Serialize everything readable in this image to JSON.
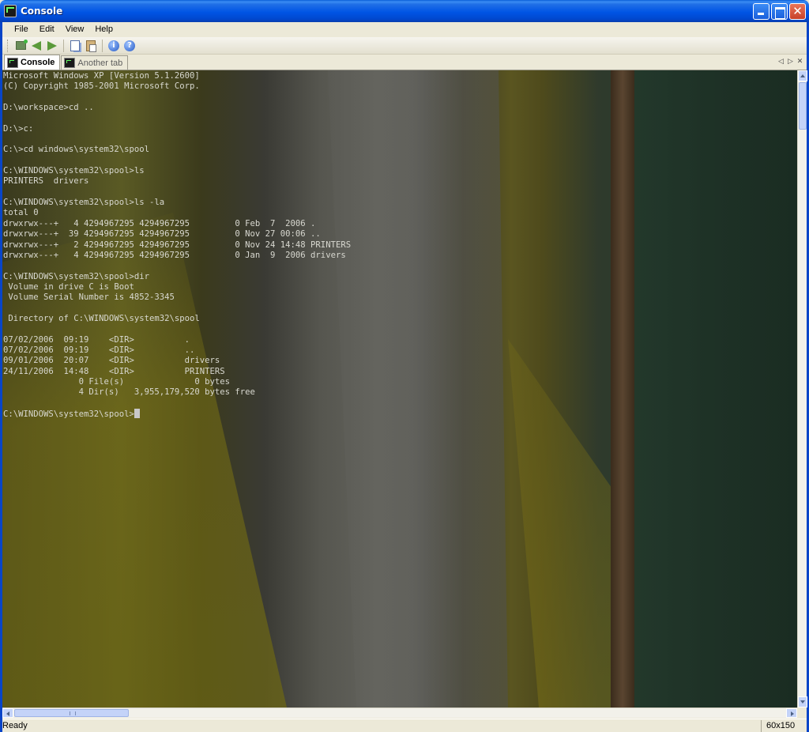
{
  "window": {
    "title": "Console",
    "icon": "console-app-icon"
  },
  "menu": {
    "items": [
      "File",
      "Edit",
      "View",
      "Help"
    ]
  },
  "toolbar": {
    "buttons": [
      "new-tab-icon",
      "back-arrow-icon",
      "forward-arrow-icon",
      "copy-icon",
      "paste-icon",
      "info-icon",
      "help-icon"
    ],
    "info_glyph": "i",
    "help_glyph": "?"
  },
  "tabs": [
    {
      "label": "Console",
      "active": true
    },
    {
      "label": "Another tab",
      "active": false
    }
  ],
  "terminal": {
    "lines": [
      "Microsoft Windows XP [Version 5.1.2600]",
      "(C) Copyright 1985-2001 Microsoft Corp.",
      "",
      "D:\\workspace>cd ..",
      "",
      "D:\\>c:",
      "",
      "C:\\>cd windows\\system32\\spool",
      "",
      "C:\\WINDOWS\\system32\\spool>ls",
      "PRINTERS  drivers",
      "",
      "C:\\WINDOWS\\system32\\spool>ls -la",
      "total 0",
      "drwxrwx---+   4 4294967295 4294967295         0 Feb  7  2006 .",
      "drwxrwx---+  39 4294967295 4294967295         0 Nov 27 00:06 ..",
      "drwxrwx---+   2 4294967295 4294967295         0 Nov 24 14:48 PRINTERS",
      "drwxrwx---+   4 4294967295 4294967295         0 Jan  9  2006 drivers",
      "",
      "C:\\WINDOWS\\system32\\spool>dir",
      " Volume in drive C is Boot",
      " Volume Serial Number is 4852-3345",
      "",
      " Directory of C:\\WINDOWS\\system32\\spool",
      "",
      "07/02/2006  09:19    <DIR>          .",
      "07/02/2006  09:19    <DIR>          ..",
      "09/01/2006  20:07    <DIR>          drivers",
      "24/11/2006  14:48    <DIR>          PRINTERS",
      "               0 File(s)              0 bytes",
      "               4 Dir(s)   3,955,179,520 bytes free",
      ""
    ],
    "prompt": "C:\\WINDOWS\\system32\\spool>"
  },
  "status": {
    "text": "Ready",
    "size": "60x150"
  },
  "colors": {
    "titlebar": "#0055e5",
    "terminal_text": "#d8d8d0",
    "chrome": "#ece9d8"
  }
}
